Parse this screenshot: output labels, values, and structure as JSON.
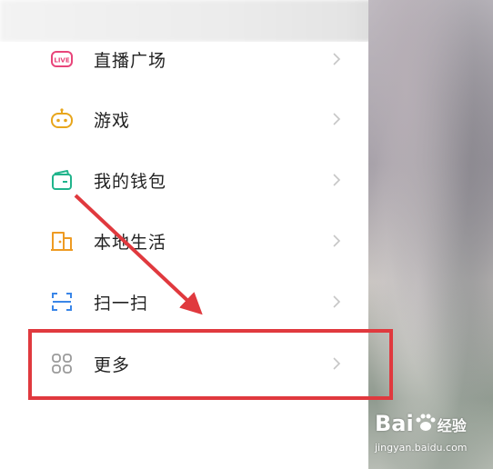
{
  "menu": {
    "items": [
      {
        "label": "直播广场",
        "icon": "live-icon",
        "color": "#e8457a"
      },
      {
        "label": "游戏",
        "icon": "game-controller-icon",
        "color": "#e8a61c"
      },
      {
        "label": "我的钱包",
        "icon": "wallet-icon",
        "color": "#21b48c"
      },
      {
        "label": "本地生活",
        "icon": "local-life-icon",
        "color": "#ee9b23"
      },
      {
        "label": "扫一扫",
        "icon": "scan-icon",
        "color": "#3a86e8"
      },
      {
        "label": "更多",
        "icon": "more-grid-icon",
        "color": "#9a9a9a"
      }
    ],
    "live_badge_text": "LIVE"
  },
  "annotation": {
    "highlight_color": "#e0393e",
    "highlighted_item": "更多"
  },
  "watermark": {
    "brand": "Bai",
    "brand_sub": "经验",
    "url": "jingyan.baidu.com"
  }
}
